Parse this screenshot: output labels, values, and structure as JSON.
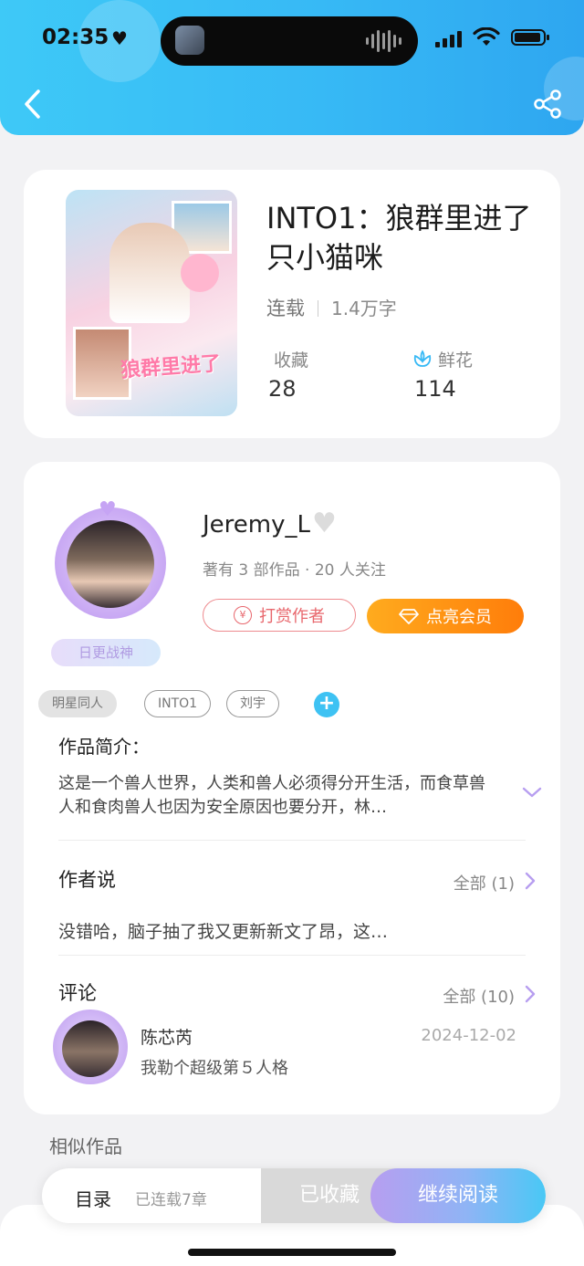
{
  "status_bar": {
    "time": "02:35"
  },
  "book": {
    "title": "INTO1：狼群里进了只小猫咪",
    "status": "连载",
    "word_count": "1.4万字",
    "favorites_label": "收藏",
    "favorites_value": "28",
    "flowers_label": "鲜花",
    "flowers_value": "114",
    "cover_text": "狼群里进了"
  },
  "author": {
    "name": "Jeremy_L",
    "stats": "著有 3 部作品 · 20 人关注",
    "badge": "日更战神",
    "tip_button": "打赏作者",
    "vip_button": "点亮会员",
    "coin_symbol": "¥"
  },
  "tags": [
    "明星同人",
    "INTO1",
    "刘宇"
  ],
  "intro": {
    "title": "作品简介：",
    "text": "这是一个兽人世界，人类和兽人必须得分开生活，而食草兽人和食肉兽人也因为安全原因也要分开，林…"
  },
  "author_says": {
    "title": "作者说",
    "more": "全部 (1)",
    "text": "没错哈，脑子抽了我又更新新文了昂，这…"
  },
  "comments": {
    "title": "评论",
    "more": "全部 (10)",
    "items": [
      {
        "name": "陈芯芮",
        "date": "2024-12-02",
        "text": "我勒个超级第５人格"
      }
    ]
  },
  "similar_title": "相似作品",
  "bottom": {
    "toc": "目录",
    "chapters": "已连载7章",
    "favorited": "已收藏",
    "continue": "继续阅读"
  },
  "colors": {
    "header": "#37b9f5",
    "accent_blue": "#3ec2f3",
    "vip_orange": "#ff8a10",
    "tip_red": "#e8676d",
    "purple": "#b79ef0"
  }
}
